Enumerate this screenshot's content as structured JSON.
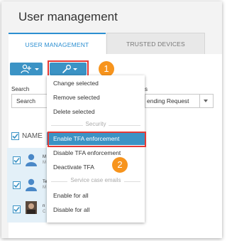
{
  "window": {
    "title": "User management"
  },
  "tabs": [
    {
      "label": "USER MANAGEMENT"
    },
    {
      "label": "TRUSTED DEVICES"
    }
  ],
  "toolbar": {
    "add_user_icon": "add-user-icon",
    "tools_icon": "wrench-icon"
  },
  "filters": {
    "search_label": "Search",
    "search_placeholder": "Search",
    "status_label_fragment": "s",
    "status_value_fragment": "ending Request"
  },
  "table": {
    "header_name": "NAME",
    "rows": [
      {
        "name_fragment": "M",
        "sub_fragment": "M"
      },
      {
        "name_fragment": "Te",
        "sub_fragment": "M"
      },
      {
        "name_fragment": "n",
        "sub_fragment": "C"
      }
    ]
  },
  "menu": {
    "items_top": [
      "Change selected",
      "Remove selected",
      "Delete selected"
    ],
    "section_security": "Security",
    "items_security": [
      "Enable TFA enforcement",
      "Disable TFA enforcement",
      "Deactivate TFA"
    ],
    "section_emails": "Service case emails",
    "items_emails": [
      "Enable for all",
      "Disable for all"
    ]
  },
  "annotations": {
    "badge_1": "1",
    "badge_2": "2"
  },
  "colors": {
    "accent": "#3b93c5",
    "highlight_box": "#e53935",
    "badge": "#f7941d"
  }
}
